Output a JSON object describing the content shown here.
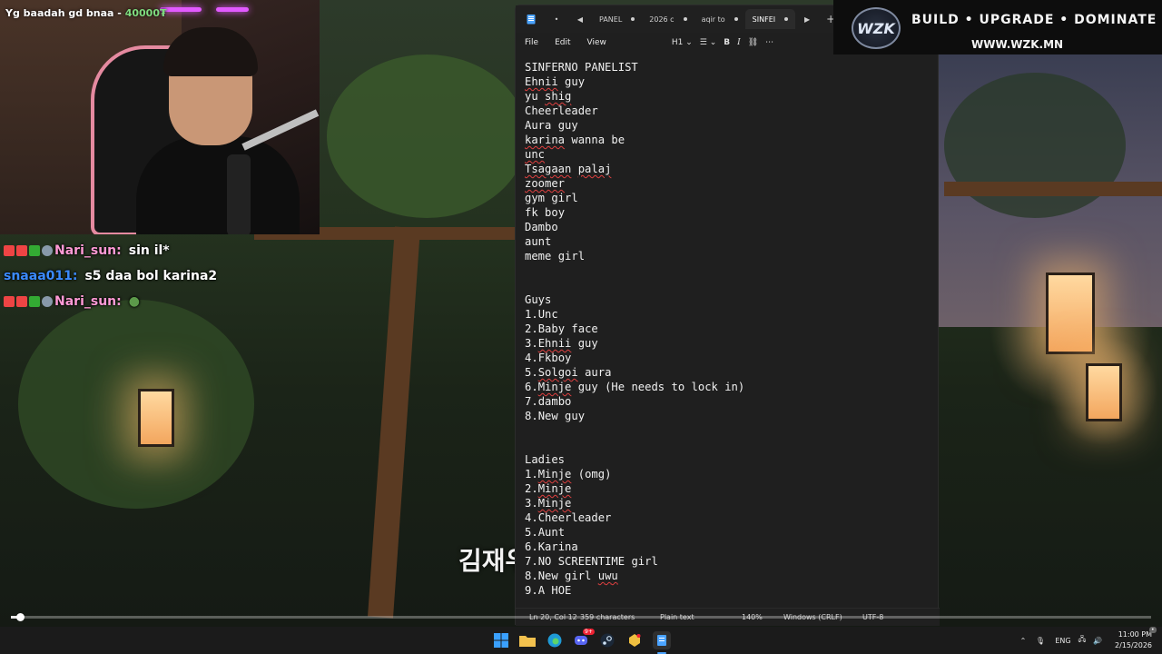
{
  "stream": {
    "cam_overlay": {
      "prefix": "Yg ba",
      "mid": "adah gd bnaa - ",
      "amount": "40000₮"
    },
    "chat": [
      {
        "user": "Nari_sun:",
        "user_color": "#ff9ad5",
        "message": "sin il*"
      },
      {
        "user": "snaaa011:",
        "user_color": "#3b8bff",
        "message": "s5 daa bol karina2"
      },
      {
        "user": "Nari_sun:",
        "user_color": "#ff9ad5",
        "message": ""
      }
    ],
    "subtitle": "김재우"
  },
  "notepad": {
    "tabs": [
      {
        "label": "PANEL",
        "active": false
      },
      {
        "label": "2026 c",
        "active": false
      },
      {
        "label": "aqir to",
        "active": false
      },
      {
        "label": "SINFEI",
        "active": true
      }
    ],
    "menu": {
      "file": "File",
      "edit": "Edit",
      "view": "View",
      "heading": "H1"
    },
    "lines": [
      "SINFERNO PANELIST",
      "Ehnii guy",
      "yu shig",
      "Cheerleader",
      "Aura guy",
      "karina wanna be",
      "unc",
      "Tsagaan palaj",
      "zoomer",
      "gym girl",
      "fk boy",
      "Dambo",
      "aunt",
      "meme girl",
      "",
      "",
      "Guys",
      "1.Unc",
      "2.Baby face",
      "3.Ehnii guy",
      "4.Fkboy",
      "5.Solgoi aura",
      "6.Minje guy (He needs to lock in)",
      "7.dambo",
      "8.New guy",
      "",
      "",
      "Ladies",
      "1.Minje (omg)",
      "2.Minje",
      "3.Minje",
      "4.Cheerleader",
      "5.Aunt",
      "6.Karina",
      "7.NO SCREENTIME girl",
      "8.New girl uwu",
      "9.A HOE"
    ],
    "status": {
      "position": "Ln 20, Col 12",
      "characters": "359 characters",
      "format": "Plain text",
      "zoom": "140%",
      "line_ending": "Windows (CRLF)",
      "encoding": "UTF-8"
    }
  },
  "sponsor": {
    "logo": "WZK",
    "slogan": "BUILD • UPGRADE • DOMINATE",
    "url": "WWW.WZK.MN"
  },
  "video": {
    "progress": 0.008
  },
  "taskbar": {
    "icons": [
      "windows-start-icon",
      "file-explorer-icon",
      "edge-browser-icon",
      "discord-icon",
      "steam-icon",
      "game-icon",
      "notepad-icon"
    ],
    "discord_badge": "9+",
    "language": "ENG",
    "time": "11:00 PM",
    "date": "2/15/2026"
  }
}
